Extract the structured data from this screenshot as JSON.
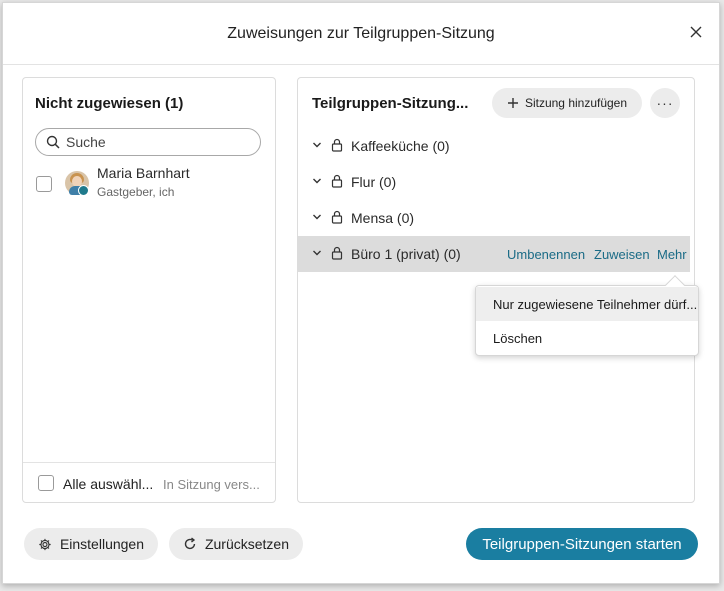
{
  "dialog": {
    "title": "Zuweisungen zur Teilgruppen-Sitzung"
  },
  "unassigned": {
    "title": "Nicht zugewiesen (1)",
    "search_placeholder": "Suche",
    "participants": [
      {
        "name": "Maria Barnhart",
        "role": "Gastgeber, ich"
      }
    ],
    "select_all_label": "Alle auswähl...",
    "move_label": "In Sitzung vers..."
  },
  "sessions": {
    "title": "Teilgruppen-Sitzung...",
    "add_label": "Sitzung hinzufügen",
    "more_label": "···",
    "items": [
      {
        "name": "Kaffeeküche (0)"
      },
      {
        "name": "Flur (0)"
      },
      {
        "name": "Mensa (0)"
      },
      {
        "name": "Büro 1 (privat) (0)"
      }
    ],
    "actions": {
      "rename": "Umbenennen",
      "assign": "Zuweisen",
      "more": "Mehr"
    },
    "menu": [
      "Nur zugewiesene Teilnehmer dürf...",
      "Löschen"
    ]
  },
  "footer": {
    "settings_label": "Einstellungen",
    "reset_label": "Zurücksetzen",
    "start_label": "Teilgruppen-Sitzungen starten"
  },
  "colors": {
    "accent": "#1a7ea1",
    "link": "#1a6b86",
    "selected_row": "#dcdcdc"
  }
}
